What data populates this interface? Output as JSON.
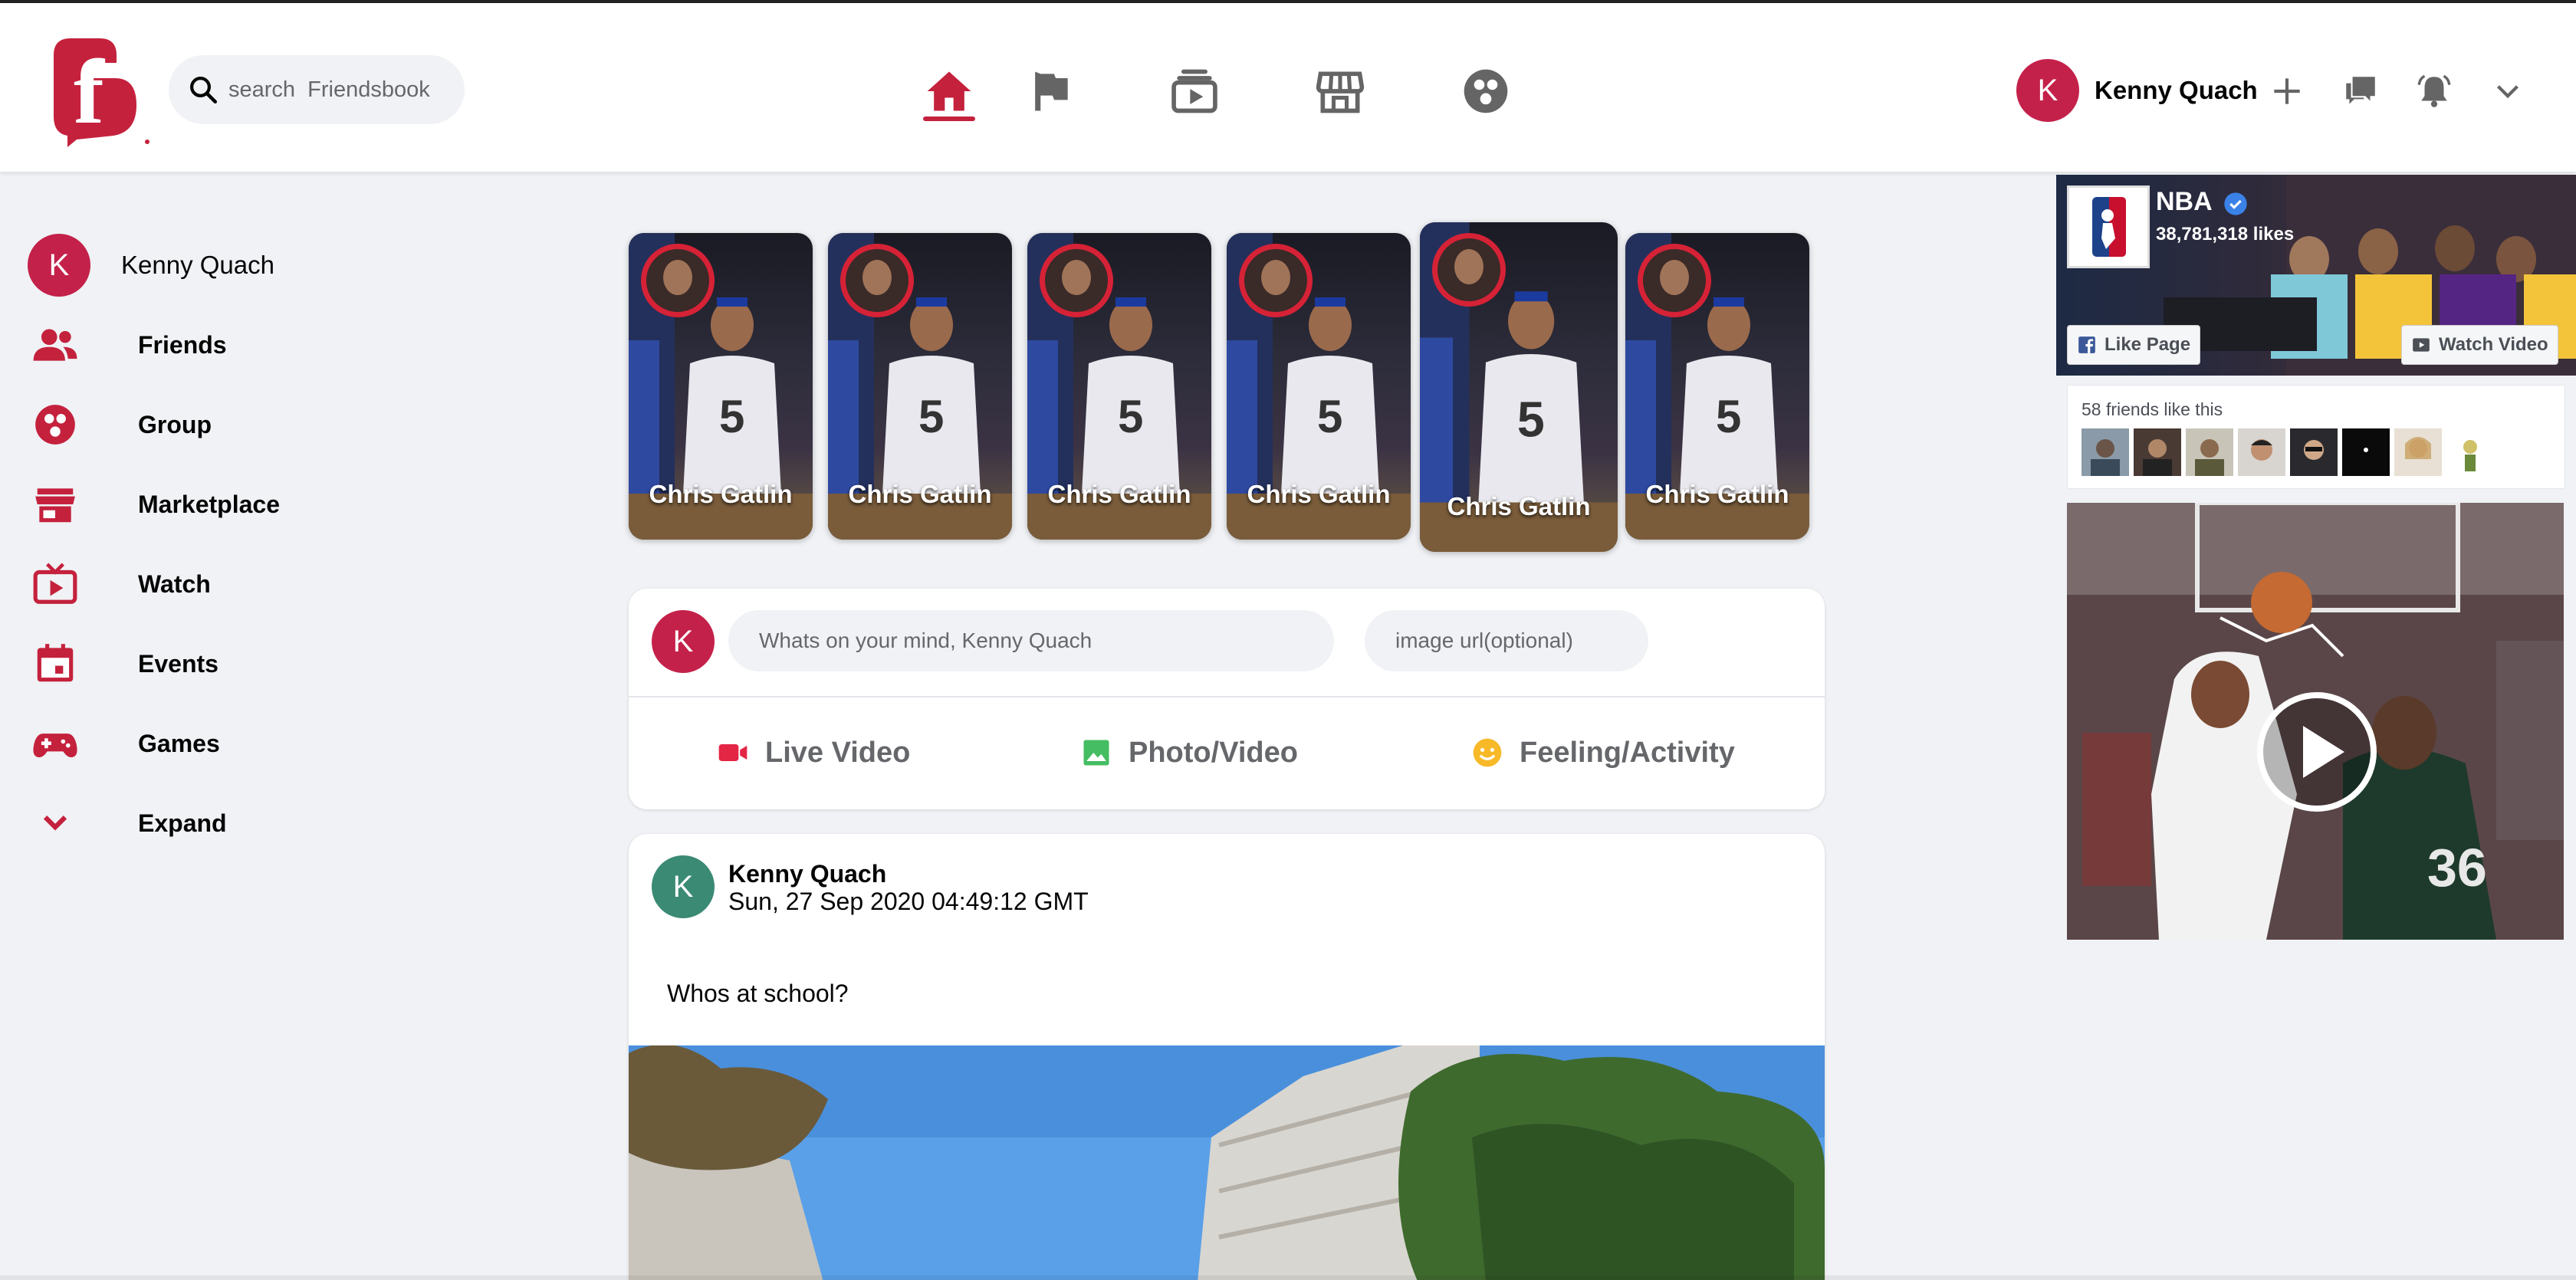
{
  "brand": {
    "accent": "#c4213d",
    "logo_letter": "f"
  },
  "header": {
    "search": {
      "placeholder": "search  Friendsbook"
    },
    "nav": [
      {
        "icon": "home-icon",
        "active": true
      },
      {
        "icon": "flag-icon",
        "active": false
      },
      {
        "icon": "watch-icon",
        "active": false
      },
      {
        "icon": "marketplace-icon",
        "active": false
      },
      {
        "icon": "groups-icon",
        "active": false
      }
    ],
    "profile": {
      "initial": "K",
      "name": "Kenny Quach"
    },
    "actions": [
      "plus-icon",
      "messenger-icon",
      "notifications-icon",
      "chevron-down-icon"
    ]
  },
  "sidebar": {
    "profile": {
      "initial": "K",
      "name": "Kenny Quach"
    },
    "items": [
      {
        "label": "Friends",
        "icon": "friends-icon"
      },
      {
        "label": "Group",
        "icon": "group-icon"
      },
      {
        "label": "Marketplace",
        "icon": "marketplace-icon"
      },
      {
        "label": "Watch",
        "icon": "watch-icon"
      },
      {
        "label": "Events",
        "icon": "calendar-icon"
      },
      {
        "label": "Games",
        "icon": "gamepad-icon"
      },
      {
        "label": "Expand",
        "icon": "chevron-down-icon"
      }
    ]
  },
  "stories": [
    {
      "name": "Chris Gatlin"
    },
    {
      "name": "Chris Gatlin"
    },
    {
      "name": "Chris Gatlin"
    },
    {
      "name": "Chris Gatlin"
    },
    {
      "name": "Chris Gatlin"
    },
    {
      "name": "Chris Gatlin"
    }
  ],
  "composer": {
    "initial": "K",
    "status_placeholder": "Whats on your mind, Kenny Quach",
    "url_placeholder": "image url(optional)",
    "actions": [
      {
        "label": "Live Video",
        "icon": "live-video-icon",
        "color": "#e42645"
      },
      {
        "label": "Photo/Video",
        "icon": "photo-icon",
        "color": "#45bd62"
      },
      {
        "label": "Feeling/Activity",
        "icon": "smiley-icon",
        "color": "#f7b928"
      }
    ]
  },
  "post": {
    "initial": "K",
    "author": "Kenny Quach",
    "date": "Sun, 27 Sep 2020 04:49:12 GMT",
    "text": "Whos at school?"
  },
  "right_rail": {
    "page": {
      "title": "NBA",
      "likes": "38,781,318 likes",
      "like_button": "Like Page",
      "watch_button": "Watch Video"
    },
    "friends_like": {
      "count": "58 friends like this"
    }
  }
}
